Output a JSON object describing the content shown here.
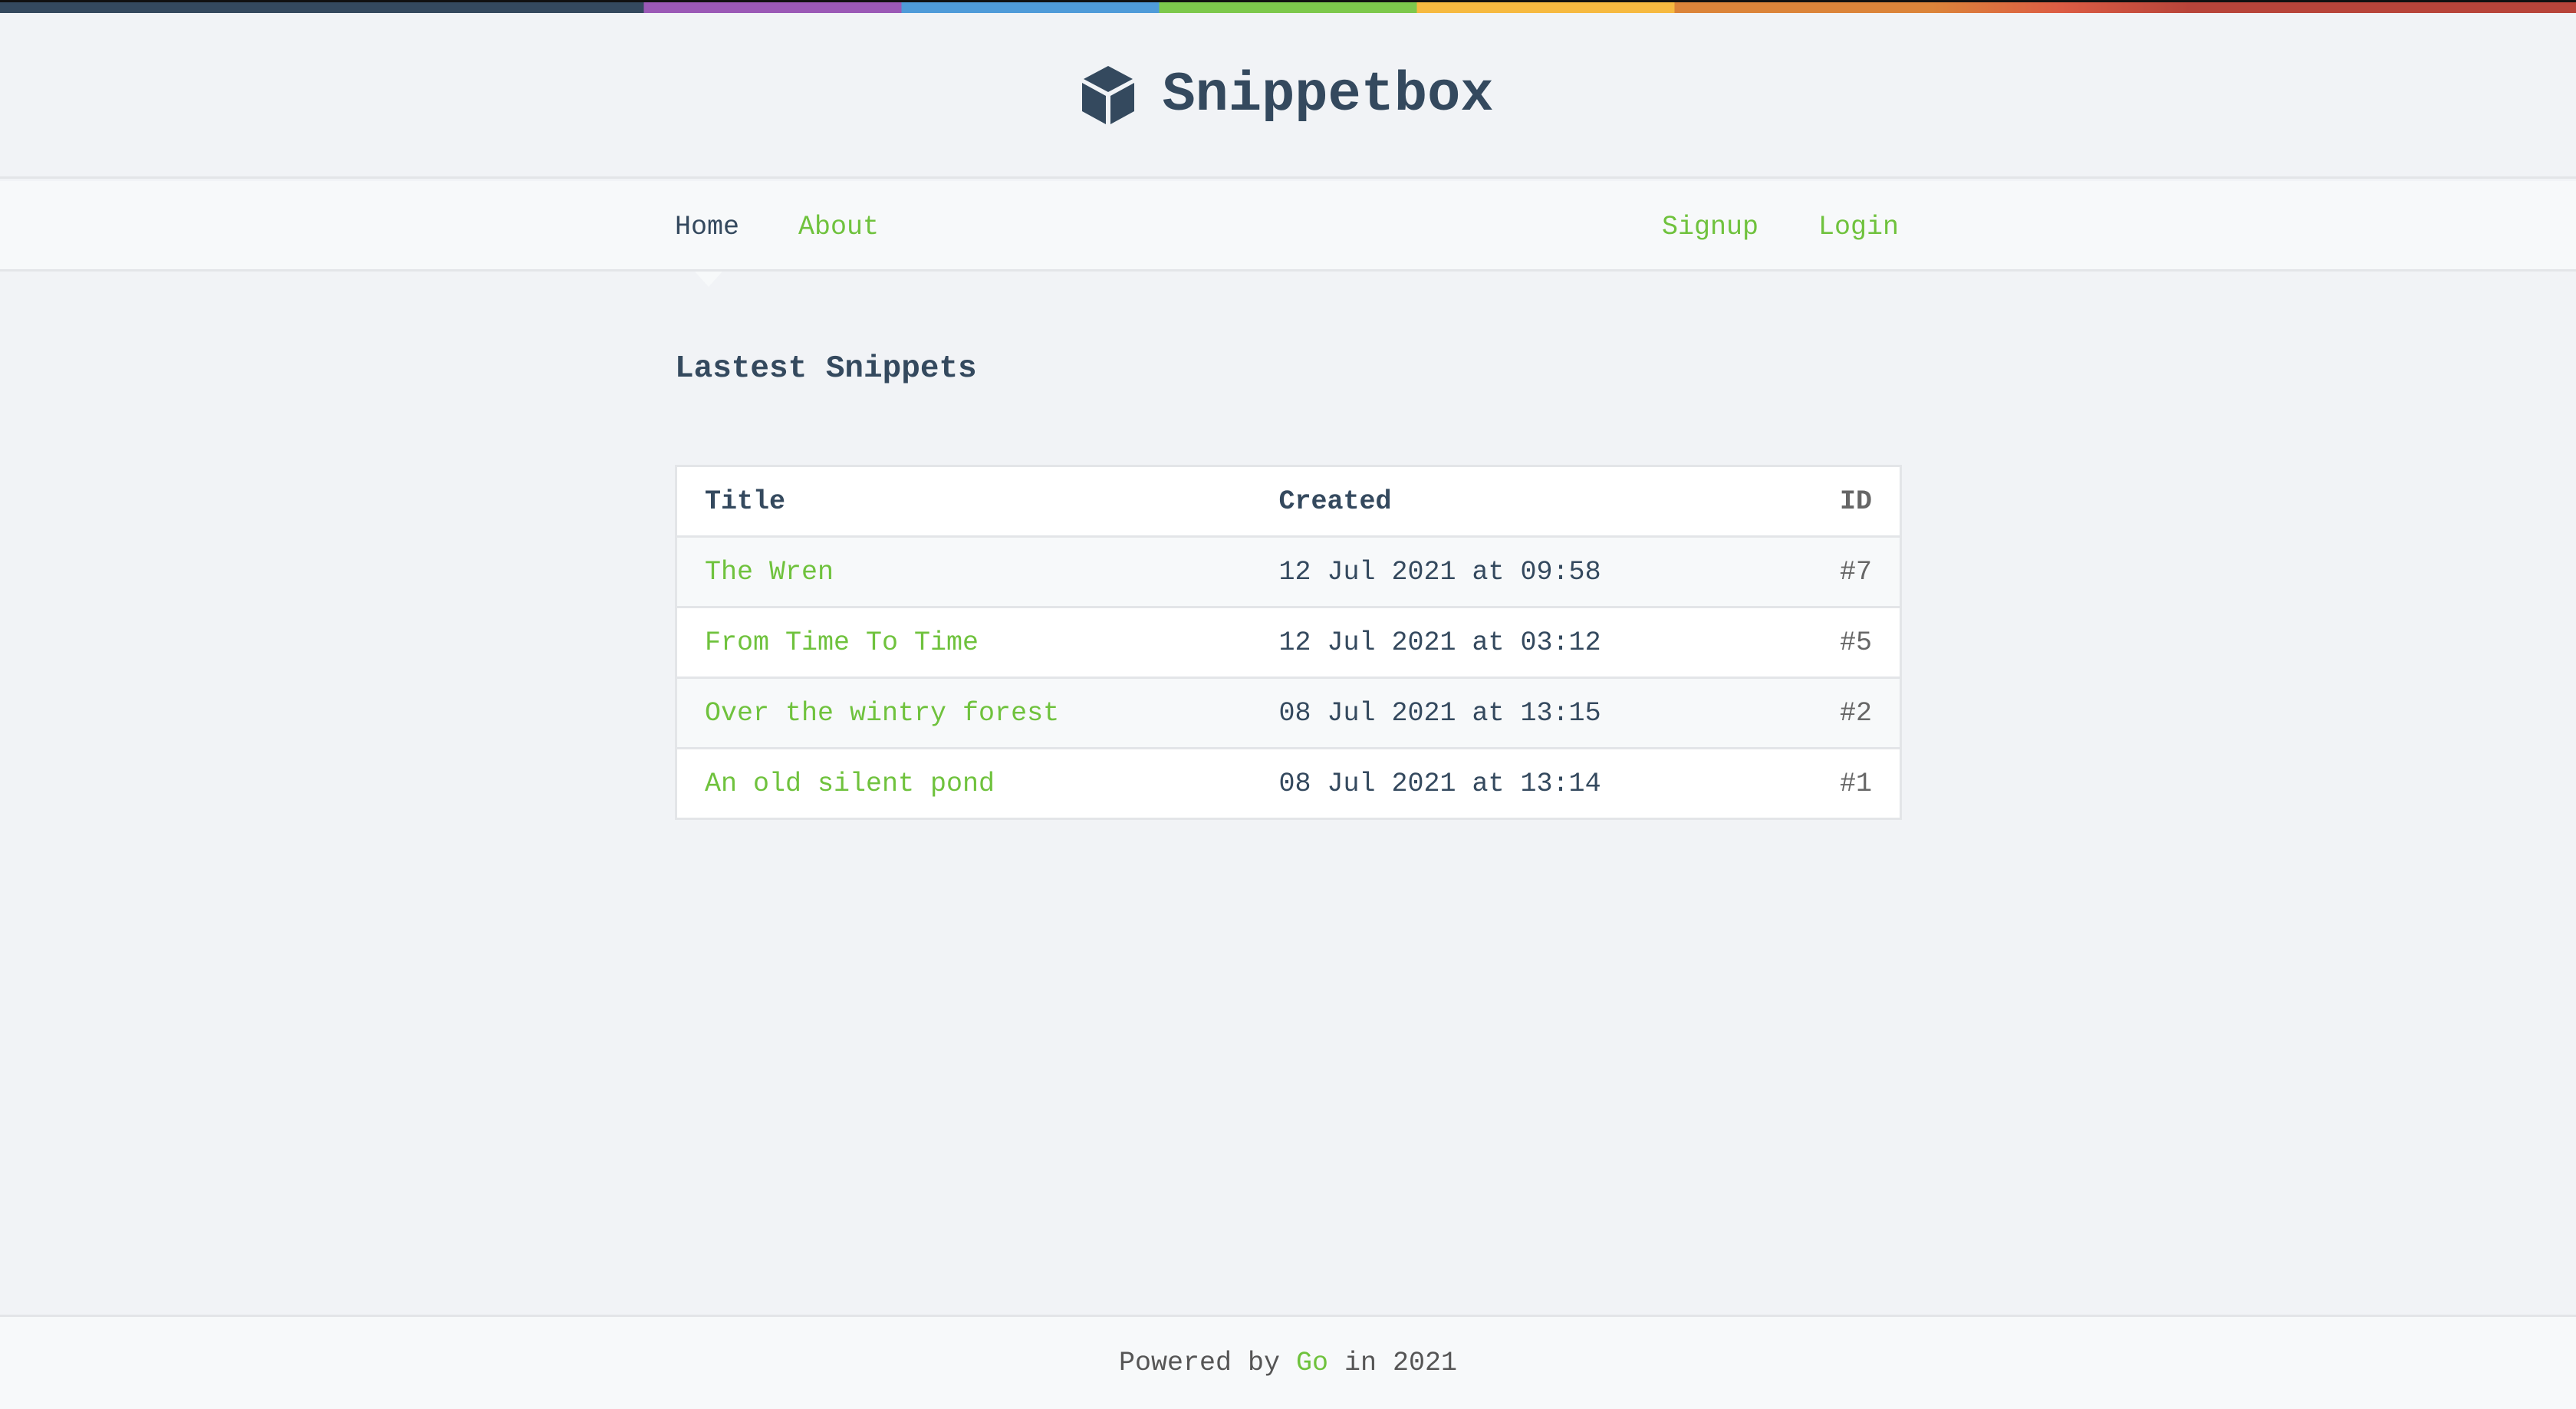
{
  "colors": {
    "dark": "#34495e",
    "accent": "#6fc23d"
  },
  "header": {
    "title": "Snippetbox",
    "icon": "cube-icon"
  },
  "nav": {
    "home": "Home",
    "about": "About",
    "signup": "Signup",
    "login": "Login"
  },
  "main": {
    "heading": "Lastest Snippets",
    "columns": [
      "Title",
      "Created",
      "ID"
    ],
    "rows": [
      {
        "title": "The Wren",
        "created": "12 Jul 2021 at 09:58",
        "id": "#7"
      },
      {
        "title": "From Time To Time",
        "created": "12 Jul 2021 at 03:12",
        "id": "#5"
      },
      {
        "title": "Over the wintry forest",
        "created": "08 Jul 2021 at 13:15",
        "id": "#2"
      },
      {
        "title": "An old silent pond",
        "created": "08 Jul 2021 at 13:14",
        "id": "#1"
      }
    ]
  },
  "footer": {
    "prefix": "Powered by",
    "link": "Go",
    "suffix": "in 2021"
  }
}
